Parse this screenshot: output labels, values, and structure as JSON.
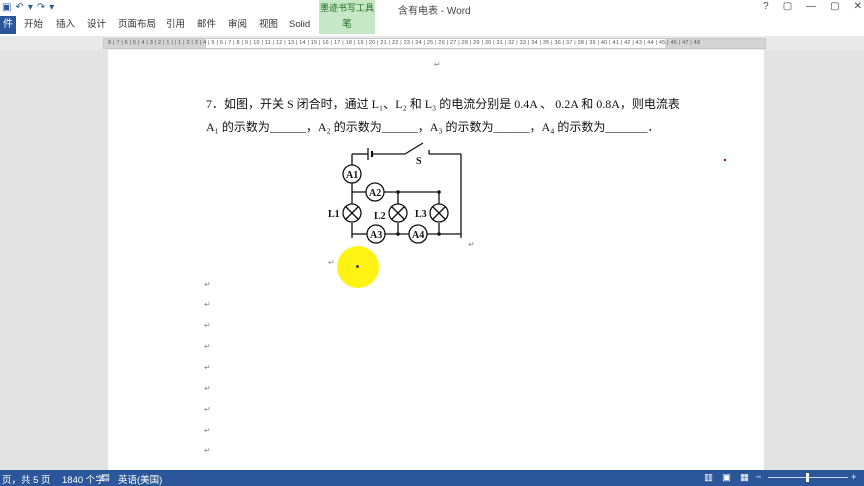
{
  "window": {
    "title": "含有电表 - Word",
    "context_tab_group": "墨迹书写工具",
    "controls": [
      "?",
      "▢",
      "—",
      "▢",
      "✕"
    ]
  },
  "ribbon": {
    "file_tab": "件",
    "tabs": [
      "开始",
      "插入",
      "设计",
      "页面布局",
      "引用",
      "邮件",
      "审阅",
      "视图",
      "Solid"
    ],
    "context_tab": "笔"
  },
  "ruler": {
    "ticks": "8 | 7 | 6 | 5 | 4 | 3 | 2 | 1 |  | 1 | 2 | 3 | 4 | 5 | 6 | 7 | 8 | 9 | 10 | 11 | 12 | 13 | 14 | 15 | 16 | 17 | 18 | 19 | 20 | 21 | 22 | 23 | 24 | 25 | 26 | 27 | 28 | 29 | 30 | 31 | 32 | 33 | 34 | 35 | 36 | 37 | 38 | 39 | 40 | 41 | 42 | 43 | 44 | 45 | 46 | 47 | 48"
  },
  "document": {
    "question_line1": "7．如图，开关 S 闭合时，通过 L₁、L₂ 和 L₃ 的电流分别是 0.4A 、 0.2A 和 0.8A，则电流表",
    "question_line2": "A₁ 的示数为______，A₂ 的示数为______，A₃ 的示数为______，A₄ 的示数为_______．",
    "paragraph_mark": "↵",
    "circuit": {
      "switch_label": "S",
      "ammeters": [
        "A1",
        "A2",
        "A3",
        "A4"
      ],
      "lamps": [
        "L1",
        "L2",
        "L3"
      ]
    }
  },
  "statusbar": {
    "page": "页，共 5 页",
    "words": "1840 个字",
    "language": "英语(美国)"
  }
}
